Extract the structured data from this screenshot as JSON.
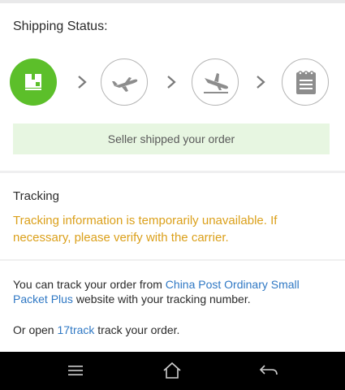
{
  "shipping": {
    "title": "Shipping Status:",
    "steps": [
      {
        "icon": "package-box-icon",
        "state": "active"
      },
      {
        "icon": "plane-takeoff-icon",
        "state": "inactive"
      },
      {
        "icon": "plane-landing-icon",
        "state": "inactive"
      },
      {
        "icon": "calendar-icon",
        "state": "inactive"
      }
    ],
    "banner": "Seller shipped your order"
  },
  "tracking": {
    "heading": "Tracking",
    "warning": "Tracking information is temporarily unavailable. If necessary, please verify with the carrier."
  },
  "info": {
    "line1_prefix": "You can track your order from ",
    "carrier_link": "China Post Ordinary Small Packet Plus",
    "line1_suffix": " website with your tracking number.",
    "line2_prefix": "Or open ",
    "app_link": "17track",
    "line2_suffix": " track your order."
  },
  "navbar": {
    "buttons": [
      "menu-icon",
      "home-icon",
      "back-icon"
    ]
  },
  "colors": {
    "accent_green": "#5cbf2a",
    "banner_bg": "#e7f6e1",
    "warning": "#dba01b",
    "link": "#2f78c4"
  }
}
